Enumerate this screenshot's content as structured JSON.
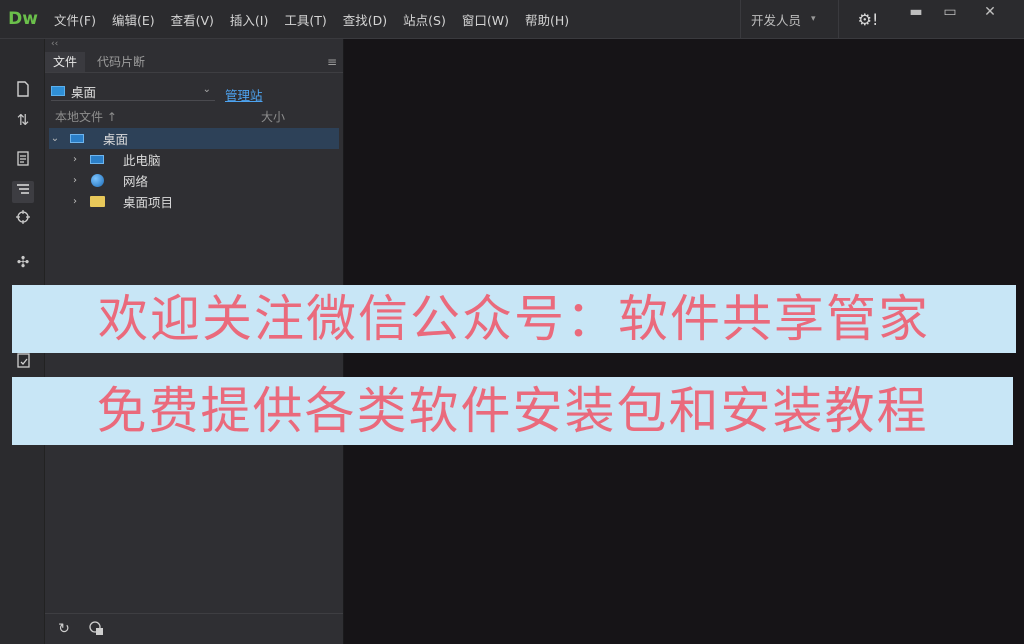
{
  "app": {
    "logo": "Dw"
  },
  "menu": [
    "文件(F)",
    "编辑(E)",
    "查看(V)",
    "插入(I)",
    "工具(T)",
    "查找(D)",
    "站点(S)",
    "窗口(W)",
    "帮助(H)"
  ],
  "workspace": {
    "label": "开发人员",
    "caret": "▾"
  },
  "settings": {
    "glyph": "⚙!"
  },
  "window_controls": {
    "minimize": "▬",
    "maximize": "▭",
    "close": "✕"
  },
  "files_panel": {
    "grip": "‹‹",
    "tabs": [
      "文件",
      "代码片断"
    ],
    "site_select": "桌面",
    "manage_link": "管理站",
    "columns": {
      "name": "本地文件 ↑",
      "size": "大小"
    },
    "tree": [
      {
        "label": "桌面",
        "icon": "desktop-icon",
        "chevron": "⌄",
        "selected": true
      },
      {
        "label": "此电脑",
        "icon": "computer-icon",
        "chevron": "›",
        "selected": false
      },
      {
        "label": "网络",
        "icon": "network-icon",
        "chevron": "›",
        "selected": false
      },
      {
        "label": "桌面项目",
        "icon": "folder-icon",
        "chevron": "›",
        "selected": false
      }
    ]
  },
  "overlay": {
    "line1": "欢迎关注微信公众号：软件共享管家",
    "line2": "免费提供各类软件安装包和安装教程"
  },
  "colors": {
    "accent": "#4da3f0",
    "logo": "#6bc04b",
    "banner_bg": "#c8e6f6",
    "banner_text": "#ea6a7c"
  }
}
